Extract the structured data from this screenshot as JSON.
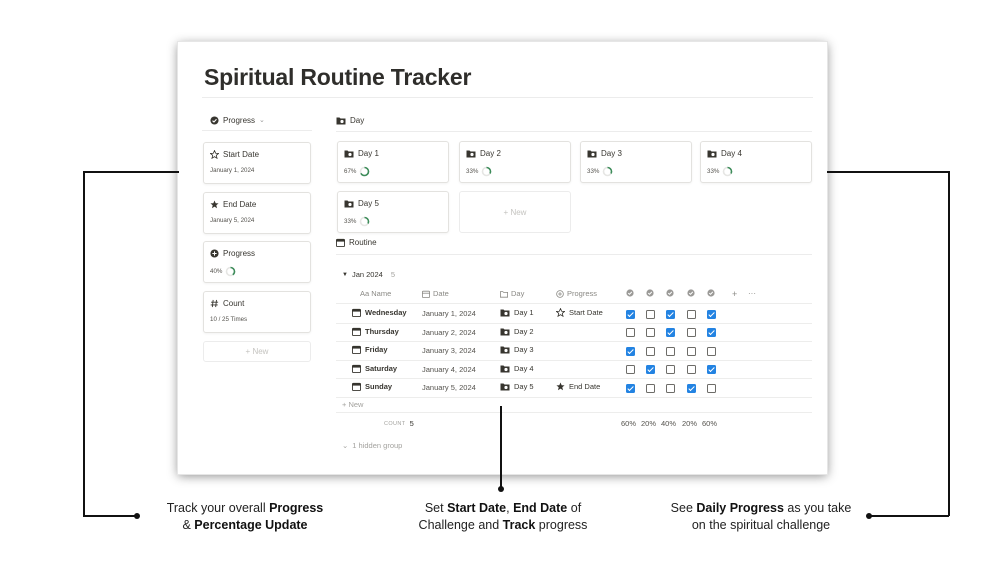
{
  "page": {
    "title": "Spiritual Routine Tracker"
  },
  "left_view": {
    "label": "Progress",
    "icon": "check-circle-icon",
    "cards": [
      {
        "key": "start",
        "title": "Start Date",
        "icon": "star-outline-icon",
        "value": "January 1, 2024"
      },
      {
        "key": "end",
        "title": "End Date",
        "icon": "star-filled-icon",
        "value": "January 5, 2024"
      },
      {
        "key": "progress",
        "title": "Progress",
        "icon": "plus-circle-icon",
        "value": "40%",
        "ring_fraction": 0.4
      },
      {
        "key": "count",
        "title": "Count",
        "icon": "hash-icon",
        "value": "10 / 25 Times"
      }
    ],
    "new_label": "+ New"
  },
  "day_view": {
    "label": "Day",
    "icon": "folder-icon",
    "cards": [
      {
        "title": "Day 1",
        "value": "67%",
        "ring_fraction": 0.67
      },
      {
        "title": "Day 2",
        "value": "33%",
        "ring_fraction": 0.33
      },
      {
        "title": "Day 3",
        "value": "33%",
        "ring_fraction": 0.33
      },
      {
        "title": "Day 4",
        "value": "33%",
        "ring_fraction": 0.33
      },
      {
        "title": "Day 5",
        "value": "33%",
        "ring_fraction": 0.33
      }
    ],
    "new_label": "+ New"
  },
  "routine": {
    "label": "Routine",
    "group": {
      "label": "Jan 2024",
      "count": "5"
    },
    "columns": {
      "name": "Aa Name",
      "date": "Date",
      "day": "Day",
      "progress": "Progress",
      "add": "+",
      "more": "···"
    },
    "rows": [
      {
        "name": "Wednesday",
        "date": "January 1, 2024",
        "day": "Day 1",
        "progress": "Start Date",
        "progress_icon": "star-outline-icon",
        "checks": [
          true,
          false,
          true,
          false,
          true
        ]
      },
      {
        "name": "Thursday",
        "date": "January 2, 2024",
        "day": "Day 2",
        "progress": "",
        "progress_icon": "",
        "checks": [
          false,
          false,
          true,
          false,
          true
        ]
      },
      {
        "name": "Friday",
        "date": "January 3, 2024",
        "day": "Day 3",
        "progress": "",
        "progress_icon": "",
        "checks": [
          true,
          false,
          false,
          false,
          false
        ]
      },
      {
        "name": "Saturday",
        "date": "January 4, 2024",
        "day": "Day 4",
        "progress": "",
        "progress_icon": "",
        "checks": [
          false,
          true,
          false,
          false,
          true
        ]
      },
      {
        "name": "Sunday",
        "date": "January 5, 2024",
        "day": "Day 5",
        "progress": "End Date",
        "progress_icon": "star-filled-icon",
        "checks": [
          true,
          false,
          false,
          true,
          false
        ]
      }
    ],
    "new_label": "+ New",
    "count_label": "COUNT",
    "count_value": "5",
    "percents": [
      "60%",
      "20%",
      "40%",
      "20%",
      "60%"
    ],
    "hidden_group": "1 hidden group"
  },
  "captions": {
    "left": {
      "line1_pre": "Track your overall ",
      "line1_bold": "Progress",
      "line2_pre": "& ",
      "line2_bold": "Percentage Update"
    },
    "center": {
      "l1_a": "Set ",
      "l1_b": "Start Date",
      "l1_c": ", ",
      "l1_d": "End Date",
      "l1_e": " of",
      "l2_a": "Challenge and ",
      "l2_b": "Track",
      "l2_c": " progress"
    },
    "right": {
      "line1_pre": "See ",
      "line1_bold": "Daily Progress",
      "line1_post": " as you take",
      "line2": "on the spiritual challenge"
    }
  },
  "colors": {
    "accent": "#2383e2",
    "ring": "#3d8c5a"
  }
}
